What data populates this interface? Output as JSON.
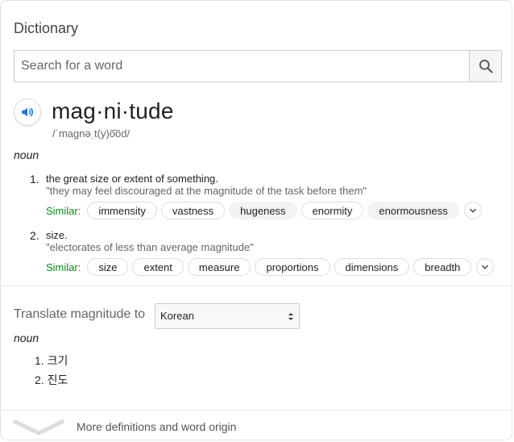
{
  "card": {
    "title": "Dictionary",
    "search_placeholder": "Search for a word"
  },
  "entry": {
    "word": "mag·ni·tude",
    "pronunciation": "/ˈmaɡnəˌt(y)o͞od/",
    "part_of_speech": "noun",
    "definitions": [
      {
        "number": "1.",
        "text": "the great size or extent of something.",
        "example": "\"they may feel discouraged at the magnitude of the task before them\"",
        "similar_label": "Similar:",
        "similar": [
          "immensity",
          "vastness",
          "hugeness",
          "enormity",
          "enormousness"
        ]
      },
      {
        "number": "2.",
        "text": "size.",
        "example": "\"electorates of less than average magnitude\"",
        "similar_label": "Similar:",
        "similar": [
          "size",
          "extent",
          "measure",
          "proportions",
          "dimensions",
          "breadth"
        ]
      }
    ]
  },
  "translate": {
    "label": "Translate magnitude to",
    "selected_language": "Korean",
    "part_of_speech": "noun",
    "items": [
      {
        "number": "1.",
        "text": "크기"
      },
      {
        "number": "2.",
        "text": "진도"
      }
    ]
  },
  "footer": {
    "more_label": "More definitions and word origin"
  },
  "icons": {
    "search": "search-icon",
    "speaker": "speaker-icon",
    "expand": "chevron-down-icon"
  },
  "colors": {
    "similar_label": "#0e8a1f",
    "speaker_accent": "#1a73e8"
  }
}
